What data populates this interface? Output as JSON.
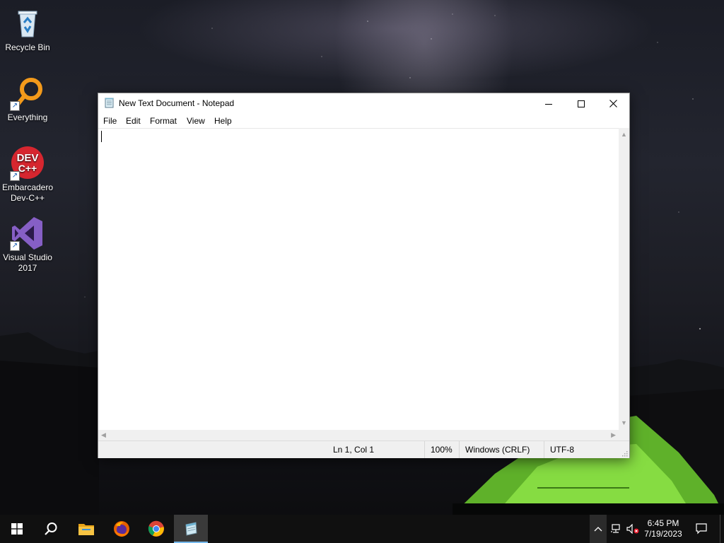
{
  "desktop": {
    "icons": [
      {
        "label": "Recycle Bin",
        "icon": "recycle-bin-icon"
      },
      {
        "label": "Everything",
        "icon": "everything-search-icon"
      },
      {
        "label_line1": "Embarcadero",
        "label_line2": "Dev-C++",
        "icon": "dev-cpp-icon",
        "badge": "DEV C++"
      },
      {
        "label_line1": "Visual Studio",
        "label_line2": "2017",
        "icon": "visual-studio-icon"
      }
    ]
  },
  "window": {
    "title": "New Text Document - Notepad",
    "menu": [
      "File",
      "Edit",
      "Format",
      "View",
      "Help"
    ],
    "content": "",
    "status": {
      "position": "Ln 1, Col 1",
      "zoom": "100%",
      "line_endings": "Windows (CRLF)",
      "encoding": "UTF-8"
    }
  },
  "taskbar": {
    "apps": [
      "start-icon",
      "search-icon",
      "file-explorer-icon",
      "firefox-icon",
      "chrome-icon",
      "notepad-icon"
    ],
    "active_app": "notepad-icon",
    "tray": [
      "chevron-up-icon",
      "network-icon",
      "volume-muted-icon",
      "notification-icon"
    ],
    "time": "6:45 PM",
    "date": "7/19/2023"
  },
  "colors": {
    "taskbar": "#101010",
    "active_indicator": "#76b9ed",
    "tent_green": "#7cd43a",
    "vs_purple": "#865fc5",
    "dev_red": "#d6262f",
    "everything_orange": "#f39a1b"
  }
}
